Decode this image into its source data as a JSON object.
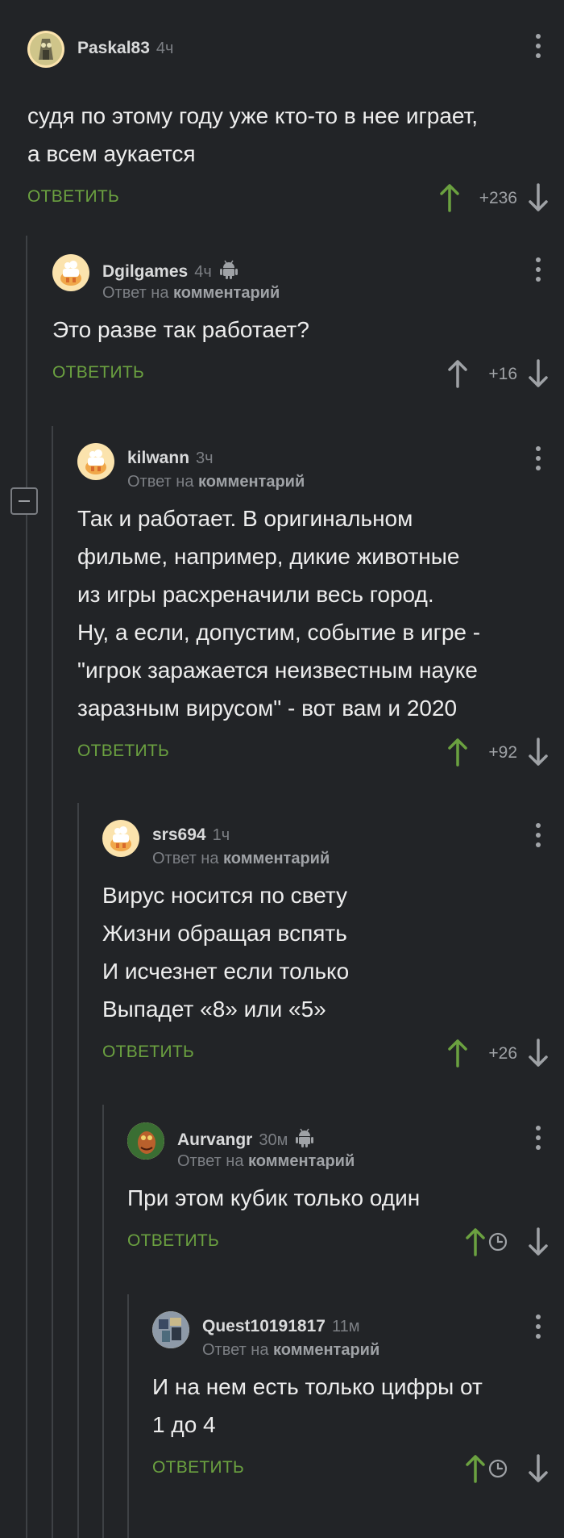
{
  "reply_label": "ОТВЕТИТЬ",
  "reply_to_prefix": "Ответ на",
  "reply_to_link": "комментарий",
  "colors": {
    "upvote_green": "#6ba140",
    "background": "#222427",
    "muted": "#7c7f84"
  },
  "comments": [
    {
      "username": "Paskal83",
      "time": "4ч",
      "is_reply": false,
      "android": false,
      "avatar_icon": "owl-avatar",
      "text_lines": [
        "судя по этому году уже кто-то в нее играет,",
        "а всем аукается"
      ],
      "score": "+236",
      "up_active": true
    },
    {
      "username": "Dgilgames",
      "time": "4ч",
      "is_reply": true,
      "android": true,
      "avatar_icon": "rooster-avatar",
      "text_lines": [
        "Это разве так работает?"
      ],
      "score": "+16",
      "up_active": false
    },
    {
      "username": "kilwann",
      "time": "3ч",
      "is_reply": true,
      "android": false,
      "avatar_icon": "rooster-avatar",
      "text_lines": [
        "Так и работает. В оригинальном",
        "фильме, например, дикие животные",
        "из игры расхреначили весь город.",
        "Ну, а если, допустим, событие в игре -",
        "\"игрок заражается неизвестным науке",
        "заразным вирусом\" - вот вам и 2020"
      ],
      "score": "+92",
      "up_active": true
    },
    {
      "username": "srs694",
      "time": "1ч",
      "is_reply": true,
      "android": false,
      "avatar_icon": "rooster-avatar",
      "text_lines": [
        "Вирус носится по свету",
        "Жизни обращая вспять",
        "И исчезнет если только",
        "Выпадет «8» или «5»"
      ],
      "score": "+26",
      "up_active": true
    },
    {
      "username": "Aurvangr",
      "time": "30м",
      "is_reply": true,
      "android": true,
      "avatar_icon": "creature-avatar",
      "text_lines": [
        "При этом кубик только один"
      ],
      "score": null,
      "up_active": true
    },
    {
      "username": "Quest10191817",
      "time": "11м",
      "is_reply": true,
      "android": false,
      "avatar_icon": "mosaic-avatar",
      "text_lines": [
        "И на нем есть только цифры от",
        "1 до 4"
      ],
      "score": null,
      "up_active": true
    }
  ]
}
